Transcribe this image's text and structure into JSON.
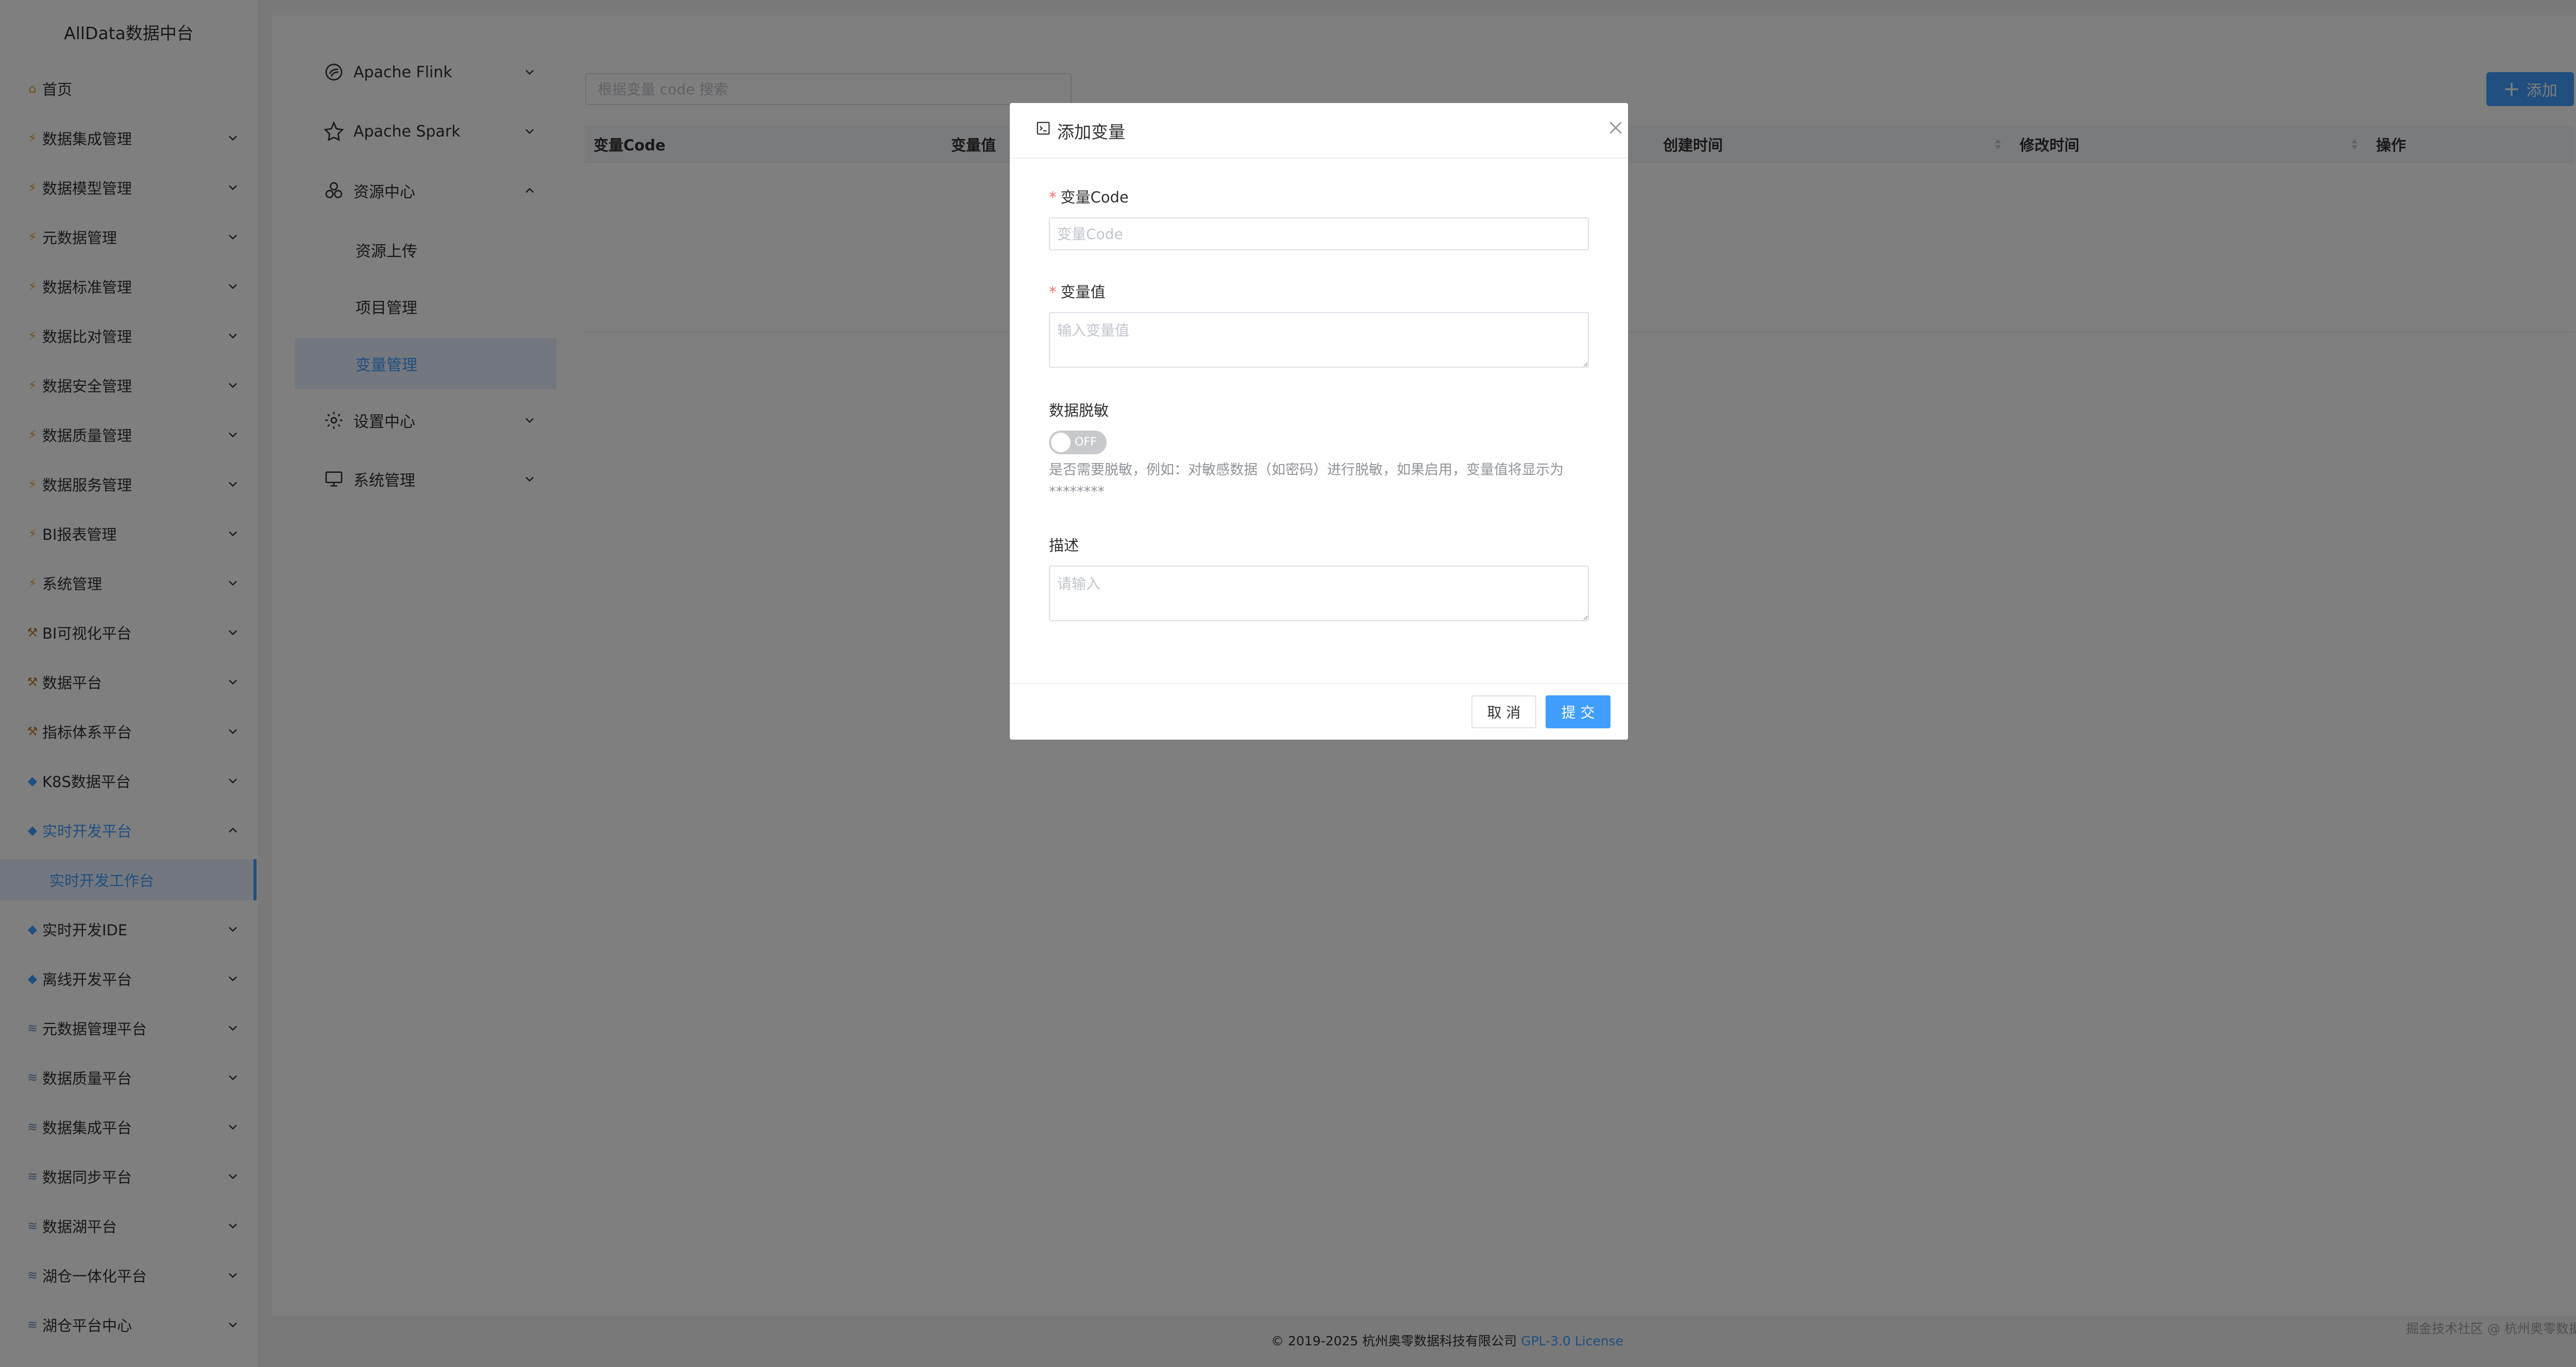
{
  "brand": "AllData数据中台",
  "nav": {
    "items": [
      {
        "label": "首页",
        "icon": "home-icon",
        "has_chevron": false
      },
      {
        "label": "数据集成管理",
        "icon": "bolt-icon",
        "has_chevron": true
      },
      {
        "label": "数据模型管理",
        "icon": "bolt-icon",
        "has_chevron": true
      },
      {
        "label": "元数据管理",
        "icon": "bolt-icon",
        "has_chevron": true
      },
      {
        "label": "数据标准管理",
        "icon": "bolt-icon",
        "has_chevron": true
      },
      {
        "label": "数据比对管理",
        "icon": "bolt-icon",
        "has_chevron": true
      },
      {
        "label": "数据安全管理",
        "icon": "bolt-icon",
        "has_chevron": true
      },
      {
        "label": "数据质量管理",
        "icon": "bolt-icon",
        "has_chevron": true
      },
      {
        "label": "数据服务管理",
        "icon": "bolt-icon",
        "has_chevron": true
      },
      {
        "label": "BI报表管理",
        "icon": "bolt-icon",
        "has_chevron": true
      },
      {
        "label": "系统管理",
        "icon": "bolt-icon",
        "has_chevron": true
      },
      {
        "label": "BI可视化平台",
        "icon": "tool-icon",
        "has_chevron": true
      },
      {
        "label": "数据平台",
        "icon": "tool-icon",
        "has_chevron": true
      },
      {
        "label": "指标体系平台",
        "icon": "tool-icon",
        "has_chevron": true
      },
      {
        "label": "K8S数据平台",
        "icon": "diamond-icon",
        "has_chevron": true
      },
      {
        "label": "实时开发平台",
        "icon": "diamond-icon",
        "has_chevron": true,
        "expanded": true
      }
    ],
    "sub_active": "实时开发工作台",
    "items_after": [
      {
        "label": "实时开发IDE",
        "icon": "diamond-icon"
      },
      {
        "label": "离线开发平台",
        "icon": "diamond-icon"
      },
      {
        "label": "元数据管理平台",
        "icon": "layers-icon"
      },
      {
        "label": "数据质量平台",
        "icon": "layers-icon"
      },
      {
        "label": "数据集成平台",
        "icon": "layers-icon"
      },
      {
        "label": "数据同步平台",
        "icon": "layers-icon"
      },
      {
        "label": "数据湖平台",
        "icon": "layers-icon"
      },
      {
        "label": "湖仓一体化平台",
        "icon": "layers-icon"
      },
      {
        "label": "湖仓平台中心",
        "icon": "layers-icon"
      }
    ]
  },
  "submenu": {
    "flink": "Apache Flink",
    "spark": "Apache Spark",
    "resource": "资源中心",
    "resource_upload": "资源上传",
    "project_mgmt": "项目管理",
    "variable_mgmt": "变量管理",
    "settings": "设置中心",
    "system": "系统管理"
  },
  "toolbar": {
    "search_placeholder": "根据变量 code 搜索",
    "add_label": "添加"
  },
  "table": {
    "columns": [
      "变量Code",
      "变量值",
      "创建时间",
      "修改时间",
      "操作"
    ]
  },
  "dialog": {
    "title": "添加变量",
    "code_label": "变量Code",
    "code_placeholder": "变量Code",
    "value_label": "变量值",
    "value_placeholder": "输入变量值",
    "mask_label": "数据脱敏",
    "mask_toggle": "OFF",
    "mask_help": "是否需要脱敏，例如：对敏感数据（如密码）进行脱敏，如果启用，变量值将显示为********",
    "desc_label": "描述",
    "desc_placeholder": "请输入",
    "cancel_label": "取 消",
    "submit_label": "提 交"
  },
  "footer": {
    "copyright": "© 2019-2025 杭州奥零数据科技有限公司 ",
    "license": "GPL-3.0 License"
  },
  "watermark": "掘金技术社区 @ 杭州奥零数据科技",
  "colors": {
    "primary": "#409eff",
    "danger": "#f56c6c",
    "overlay": "rgba(0,0,0,0.5)"
  }
}
